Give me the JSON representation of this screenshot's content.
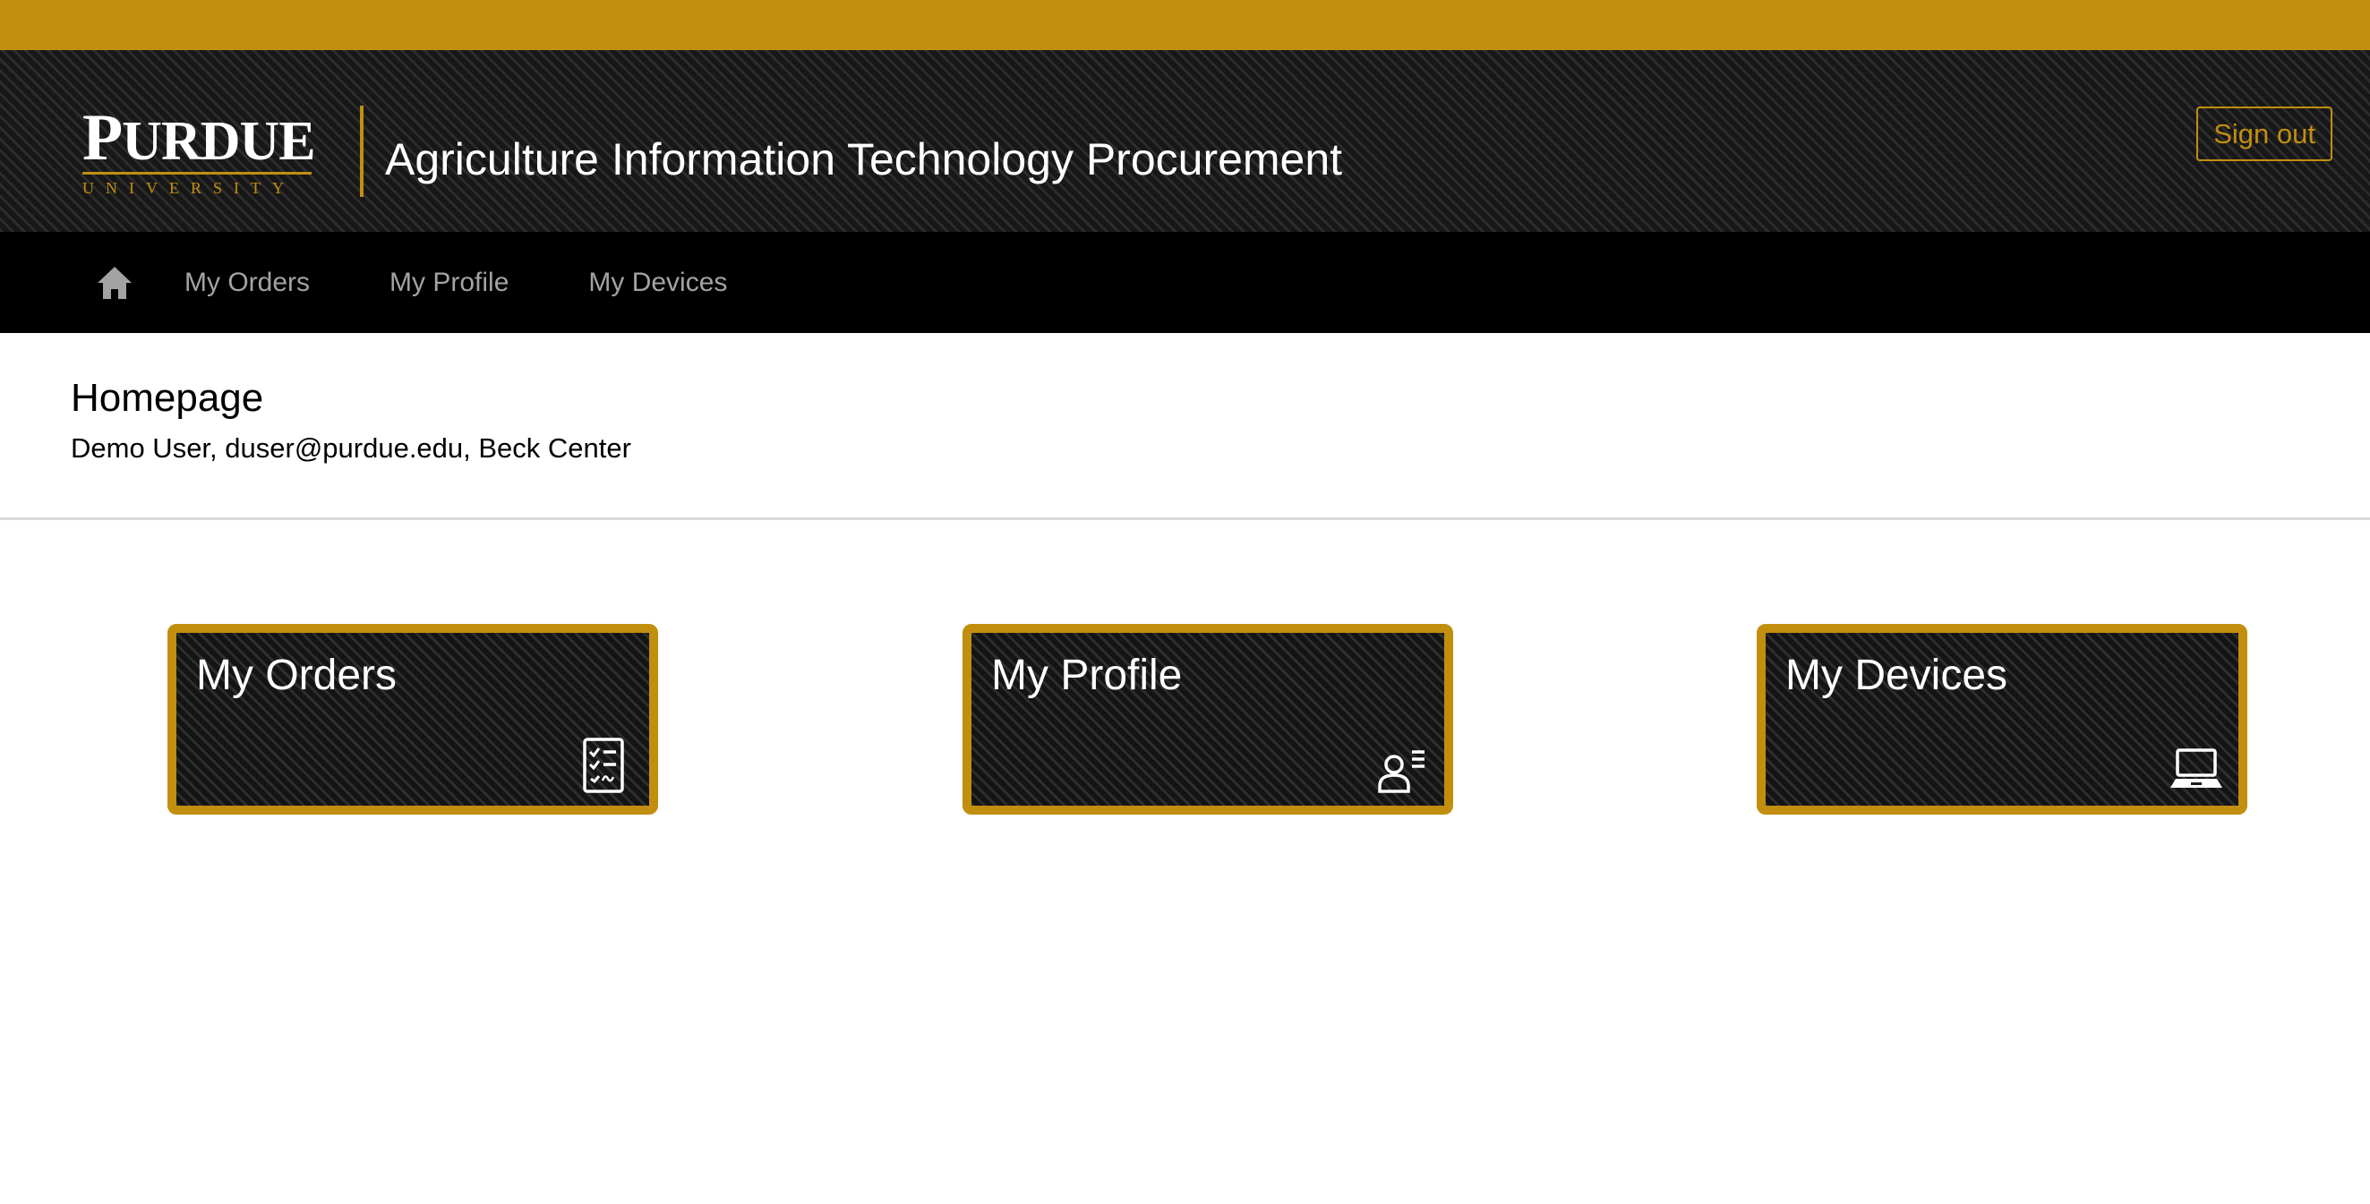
{
  "header": {
    "logo_word_initial": "P",
    "logo_word_rest": "URDUE",
    "logo_sub": "UNIVERSITY",
    "app_title": "Agriculture Information Technology Procurement",
    "signout_label": "Sign out"
  },
  "nav": {
    "home_icon": "home-icon",
    "items": [
      {
        "label": "My Orders"
      },
      {
        "label": "My Profile"
      },
      {
        "label": "My Devices"
      }
    ]
  },
  "page": {
    "title": "Homepage",
    "user_info": "Demo User, duser@purdue.edu, Beck Center"
  },
  "tiles": [
    {
      "title": "My Orders",
      "icon": "checklist-icon"
    },
    {
      "title": "My Profile",
      "icon": "user-profile-icon"
    },
    {
      "title": "My Devices",
      "icon": "laptop-icon"
    }
  ],
  "colors": {
    "gold": "#c28e0e",
    "black": "#000000",
    "nav_text": "#a3a3a3"
  }
}
